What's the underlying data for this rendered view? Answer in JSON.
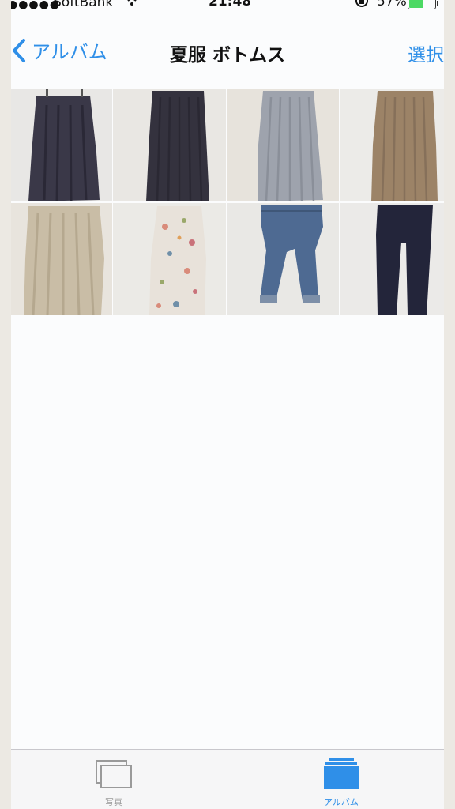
{
  "status_bar": {
    "signal": "●●●●●",
    "carrier": "SoftBank",
    "time": "21:48",
    "battery_percent": "57%",
    "battery_level": 0.57,
    "icons": [
      "signal-dots-icon",
      "wifi-icon",
      "rotation-lock-icon",
      "battery-icon"
    ]
  },
  "nav": {
    "back_label": "アルバム",
    "title": "夏服 ボトムス",
    "select_label": "選択"
  },
  "photos": [
    {
      "subject": "dark navy gathered skirt",
      "colors": {
        "bg": "#ecebea",
        "item": "#3a3848"
      }
    },
    {
      "subject": "dark navy pleated skirt",
      "colors": {
        "bg": "#e9e7e3",
        "item": "#34323e"
      }
    },
    {
      "subject": "light grey-blue pleated skirt",
      "colors": {
        "bg": "#e7e3dc",
        "item": "#9ea3ad"
      }
    },
    {
      "subject": "beige pleated skirt",
      "colors": {
        "bg": "#ecebe8",
        "item": "#9c8367"
      }
    },
    {
      "subject": "light beige gathered skirt",
      "colors": {
        "bg": "#e8e4dd",
        "item": "#c9bda6"
      }
    },
    {
      "subject": "floral print skirt",
      "colors": {
        "bg": "#ebeae6",
        "item": "#e8e2da"
      }
    },
    {
      "subject": "blue denim jeans",
      "colors": {
        "bg": "#e9e8e5",
        "item": "#4e6a92"
      }
    },
    {
      "subject": "navy slim pants",
      "colors": {
        "bg": "#ebeae8",
        "item": "#23253a"
      }
    }
  ],
  "tabbar": {
    "photos_label": "写真",
    "albums_label": "アルバム"
  },
  "colors": {
    "accent": "#2f8fe8",
    "battery_green": "#4cd964"
  }
}
